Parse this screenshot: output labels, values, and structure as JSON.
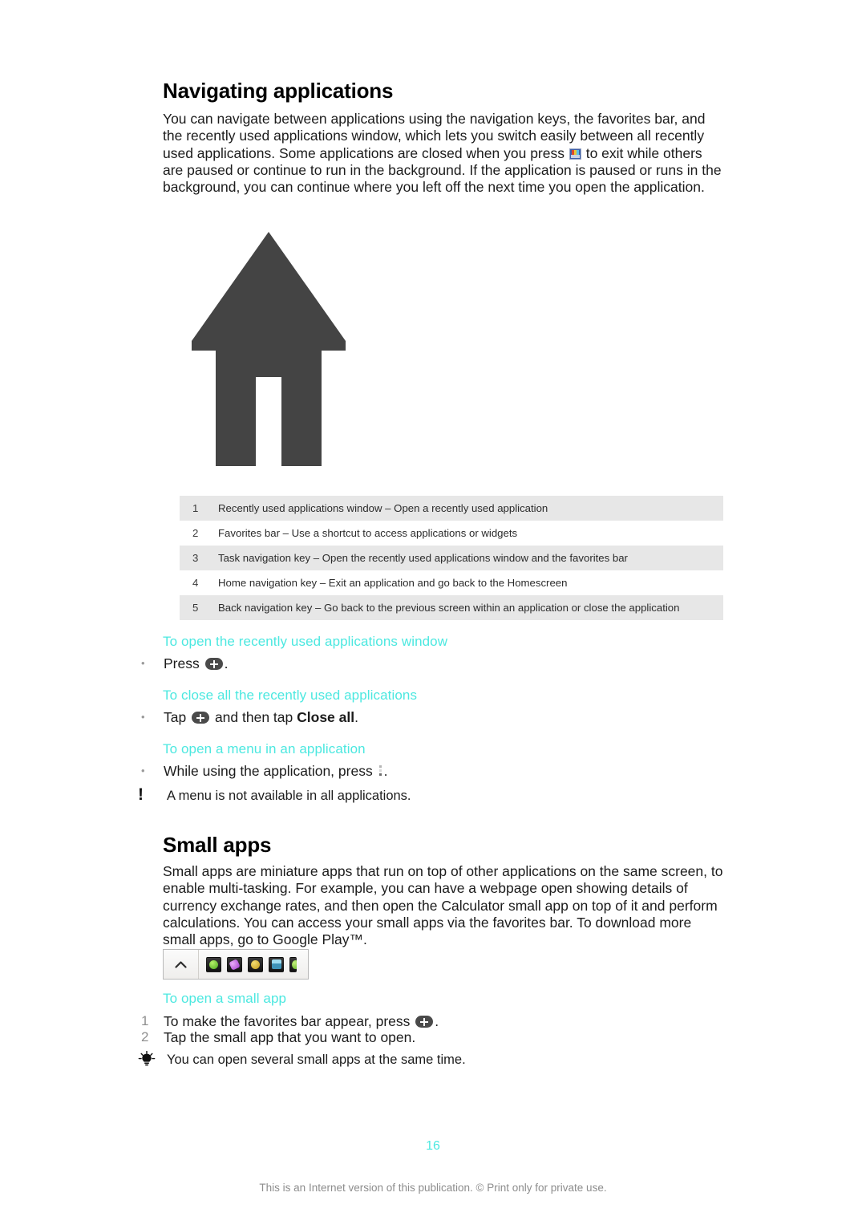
{
  "document": {
    "section_navigating": {
      "title": "Navigating applications",
      "intro_before_icon": "You can navigate between applications using the navigation keys, the favorites bar, and the recently used applications window, which lets you switch easily between all recently used applications. Some applications are closed when you press ",
      "intro_after_icon": " to exit while others are paused or continue to run in the background. If the application is paused or runs in the background, you can continue where you left off the next time you open the application.",
      "figure": {
        "icon_name": "navigation-arrow-illustration",
        "color": "#444444"
      },
      "legend": {
        "rows": [
          {
            "num": "1",
            "text": "Recently used applications window – Open a recently used application"
          },
          {
            "num": "2",
            "text": "Favorites bar – Use a shortcut to access applications or widgets"
          },
          {
            "num": "3",
            "text": "Task navigation key – Open the recently used applications window and the favorites bar"
          },
          {
            "num": "4",
            "text": "Home navigation key – Exit an application and go back to the Homescreen"
          },
          {
            "num": "5",
            "text": "Back navigation key – Go back to the previous screen within an application or close the application"
          }
        ]
      },
      "task_open_recents": {
        "heading": "To open the recently used applications window",
        "bullet_marker": "•",
        "step_before_icon": "Press ",
        "step_after_icon": "."
      },
      "task_close_all": {
        "heading": "To close all the recently used applications",
        "bullet_marker": "•",
        "step_before_icon": "Tap ",
        "step_middle": " and then tap ",
        "step_bold": "Close all",
        "step_after": "."
      },
      "task_open_menu": {
        "heading": "To open a menu in an application",
        "bullet_marker": "•",
        "step_before_icon": "While using the application, press ",
        "step_after_icon": "."
      },
      "note_warning": {
        "icon_name": "exclamation-note-icon",
        "text": "A menu is not available in all applications."
      }
    },
    "section_small_apps": {
      "title": "Small apps",
      "intro": "Small apps are miniature apps that run on top of other applications on the same screen, to enable multi-tasking. For example, you can have a webpage open showing details of currency exchange rates, and then open the Calculator small app on top of it and perform calculations. You can access your small apps via the favorites bar. To download more small apps, go to Google Play™.",
      "favorites_bar": {
        "expand_icon_name": "chevron-up-icon",
        "apps": [
          {
            "name": "small-app-green",
            "color": "#5bbf2a"
          },
          {
            "name": "small-app-purple",
            "color": "#c35ce0"
          },
          {
            "name": "small-app-gold",
            "color": "#d8b128"
          },
          {
            "name": "small-app-calculator",
            "color": "#4fb6dd"
          },
          {
            "name": "small-app-partial",
            "color": "#7fbf3a"
          }
        ]
      },
      "task_open_small_app": {
        "heading": "To open a small app",
        "steps": [
          {
            "num": "1",
            "before_icon": "To make the favorites bar appear, press ",
            "after_icon": "."
          },
          {
            "num": "2",
            "before_icon": "Tap the small app that you want to open.",
            "after_icon": ""
          }
        ]
      },
      "note_tip": {
        "icon_name": "lightbulb-tip-icon",
        "text": "You can open several small apps at the same time."
      }
    },
    "footer": {
      "page_number": "16",
      "notice": "This is an Internet version of this publication. © Print only for private use."
    },
    "colors": {
      "heading_accent": "#4ce8e0",
      "table_stripe": "#e7e7e7",
      "footer_text": "#8d8d8d",
      "body_text": "#1c1c1c"
    }
  }
}
